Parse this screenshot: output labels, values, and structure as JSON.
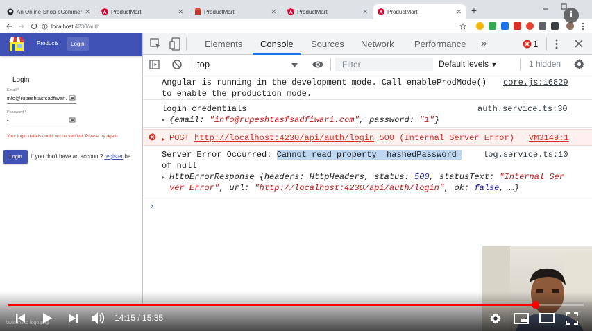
{
  "browser": {
    "tabs": [
      {
        "title": "An Online-Shop-eCommerce-Ap",
        "icon": "github-icon"
      },
      {
        "title": "ProductMart",
        "icon": "angular-icon"
      },
      {
        "title": "ProductMart",
        "icon": "shop-icon"
      },
      {
        "title": "ProductMart",
        "icon": "angular-icon"
      },
      {
        "title": "ProductMart",
        "icon": "angular-icon",
        "active": true
      }
    ],
    "close_glyph": "✕",
    "new_tab_glyph": "+",
    "url_host": "localhost",
    "url_path": ":4230/auth"
  },
  "app": {
    "nav": {
      "products": "Products",
      "login": "Login"
    },
    "login_title": "Login",
    "email_label": "Email *",
    "email_value": "info@rupeshtasfsadfiwari.",
    "password_label": "Password *",
    "password_value": "•",
    "error_text": "Your login details could not be verified. Please try again",
    "login_button": "Login",
    "register_prompt": "If you don't have an account?",
    "register_link": "register",
    "register_suffix": "he"
  },
  "devtools": {
    "tabs": [
      "Elements",
      "Console",
      "Sources",
      "Network",
      "Performance"
    ],
    "more_glyph": "»",
    "error_count": "1",
    "context": "top",
    "filter_placeholder": "Filter",
    "levels": "Default levels",
    "hidden": "1 hidden",
    "messages": {
      "angular_line1": "Angular is running in the development mode. Call enableProdMode()",
      "angular_line2": "to enable the production mode.",
      "angular_src": "core.js:16829",
      "creds_title": "login credentials",
      "creds_src": "auth.service.ts:30",
      "creds_open": "{",
      "creds_email_key": "email: ",
      "creds_email_val": "\"info@rupeshtasfsadfiwari.com\"",
      "creds_sep": ", ",
      "creds_password_key": "password: ",
      "creds_password_val": "\"1\"",
      "creds_close": "}",
      "post_method": "POST ",
      "post_url": "http://localhost:4230/api/auth/login",
      "post_status": " 500 (Internal Server Error)",
      "post_src": "VM3149:1",
      "server_prefix": "Server Error Occurred: ",
      "server_highlight": "Cannot read property 'hashedPassword'",
      "server_line2": "of null",
      "server_src": "log.service.ts:10",
      "resp_type": "HttpErrorResponse ",
      "resp_line1_a": "{headers: HttpHeaders, status: ",
      "resp_status": "500",
      "resp_line1_b": ", statusText: ",
      "resp_line1_c": "\"Internal Ser",
      "resp_line2_a": "ver Error\"",
      "resp_line2_b": ", url: ",
      "resp_line2_c": "\"http://localhost:4230/api/auth/login\"",
      "resp_line2_d": ", ok: ",
      "resp_line2_e": "false",
      "resp_line2_f": ", …}",
      "prompt": "›"
    }
  },
  "video": {
    "time": "14:15 / 15:35",
    "progress": 0.915,
    "info_glyph": "i",
    "downloads": "favicon.ico          logo.png"
  },
  "colors": {
    "accent": "#3f51b5",
    "error": "#e53935",
    "youtube_red": "#ff0000",
    "devtools_blue": "#1a73e8"
  }
}
